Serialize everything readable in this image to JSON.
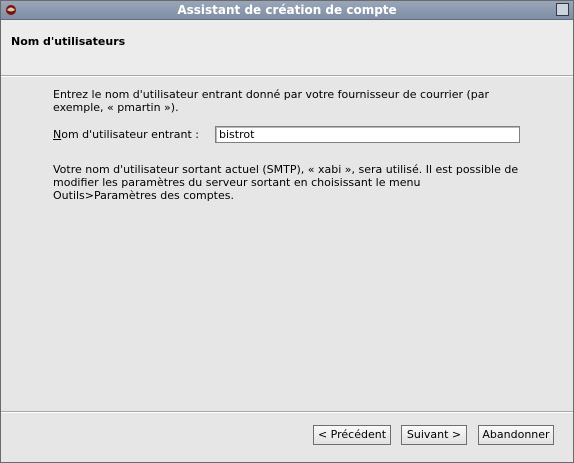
{
  "window": {
    "title": "Assistant de création de compte"
  },
  "header": {
    "title": "Nom d'utilisateurs"
  },
  "content": {
    "intro": "Entrez le nom d'utilisateur entrant donné par votre fournisseur de courrier (par exemple, « pmartin »).",
    "incoming_label_mnemonic": "N",
    "incoming_label_rest": "om d'utilisateur entrant  :",
    "incoming_value": "bistrot",
    "outgoing_text": "Votre nom d'utilisateur sortant actuel (SMTP), « xabi », sera utilisé. Il est possible de modifier les paramètres du serveur sortant en choisissant le menu Outils>Paramètres des comptes."
  },
  "buttons": {
    "previous": "< Précédent",
    "next": "Suivant >",
    "cancel": "Abandonner"
  },
  "icons": {
    "app": "thunderbird-icon",
    "maximize": "maximize-icon"
  }
}
